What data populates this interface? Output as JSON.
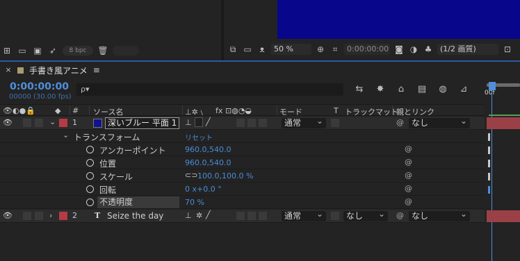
{
  "project": {
    "bpc": "8 bpc"
  },
  "comp_viewer": {
    "zoom": "50 %",
    "timecode": "0:00:00:00",
    "resolution": "(1/2 画質)",
    "colors": {
      "comp_bg": "#08068a"
    }
  },
  "timeline": {
    "tab_title": "手書き風アニメ",
    "menu_icon": "≡",
    "timecode": "0:00:00:00",
    "fps": "00000 (30.00 fps)",
    "search_placeholder": "ρ▾",
    "ruler_label": "00f",
    "headers": {
      "num": "#",
      "source_name": "ソース名",
      "fx": "fx",
      "mode": "モード",
      "t": "T",
      "trackmatte": "トラックマット",
      "parent": "親とリンク"
    },
    "layers": [
      {
        "num": "1",
        "name": "深いブルー 平面 1",
        "mode": "通常",
        "parent": "なし",
        "transform": {
          "label": "トランスフォーム",
          "reset": "リセット",
          "props": [
            {
              "name": "アンカーポイント",
              "value": "960.0,540.0"
            },
            {
              "name": "位置",
              "value": "960.0,540.0"
            },
            {
              "name": "スケール",
              "value": "100.0,100.0 %"
            },
            {
              "name": "回転",
              "value": "0 x+0.0 °"
            },
            {
              "name": "不透明度",
              "value": "70 %"
            }
          ]
        }
      },
      {
        "num": "2",
        "type_icon": "T",
        "name": "Seize the day",
        "mode": "通常",
        "trackmatte": "なし",
        "parent": "なし"
      }
    ]
  }
}
